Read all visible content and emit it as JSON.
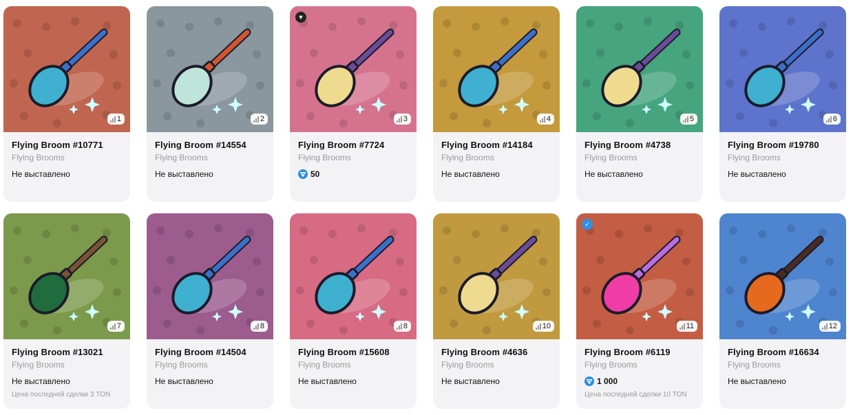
{
  "rank_icon": "signal-bars-icon",
  "cards": [
    {
      "title": "Flying Broom #10771",
      "collection": "Flying Brooms",
      "status": "Не выставлено",
      "price": "",
      "last_sale": "",
      "rank": "1",
      "bg": "#c0654f",
      "handle": "#3c6fc8",
      "brush": "#3fb0cf",
      "badge": "",
      "badge_color": ""
    },
    {
      "title": "Flying Broom #14554",
      "collection": "Flying Brooms",
      "status": "Не выставлено",
      "price": "",
      "last_sale": "",
      "rank": "2",
      "bg": "#8a979f",
      "handle": "#d2552f",
      "brush": "#bfe4da",
      "badge": "",
      "badge_color": ""
    },
    {
      "title": "Flying Broom #7724",
      "collection": "Flying Brooms",
      "status": "",
      "price": "50",
      "last_sale": "",
      "rank": "3",
      "bg": "#d5738f",
      "handle": "#6a4c97",
      "brush": "#eedb8f",
      "badge": "telegram-icon",
      "badge_color": "#222222"
    },
    {
      "title": "Flying Broom #14184",
      "collection": "Flying Brooms",
      "status": "Не выставлено",
      "price": "",
      "last_sale": "",
      "rank": "4",
      "bg": "#c49a3c",
      "handle": "#3c6fc8",
      "brush": "#3fb0cf",
      "badge": "",
      "badge_color": ""
    },
    {
      "title": "Flying Broom #4738",
      "collection": "Flying Brooms",
      "status": "Не выставлено",
      "price": "",
      "last_sale": "",
      "rank": "5",
      "bg": "#46a47f",
      "handle": "#6a4c97",
      "brush": "#eedb8f",
      "badge": "",
      "badge_color": ""
    },
    {
      "title": "Flying Broom #19780",
      "collection": "Flying Brooms",
      "status": "Не выставлено",
      "price": "",
      "last_sale": "",
      "rank": "6",
      "bg": "#5e73cc",
      "handle": "#3c6fc8",
      "brush": "#3fb0cf",
      "badge": "",
      "badge_color": ""
    },
    {
      "title": "Flying Broom #13021",
      "collection": "Flying Brooms",
      "status": "Не выставлено",
      "price": "",
      "last_sale": "Цена последней сделки 3 TON",
      "rank": "7",
      "bg": "#7c9a4c",
      "handle": "#7a5234",
      "brush": "#1f6c3c",
      "badge": "",
      "badge_color": ""
    },
    {
      "title": "Flying Broom #14504",
      "collection": "Flying Brooms",
      "status": "Не выставлено",
      "price": "",
      "last_sale": "",
      "rank": "8",
      "bg": "#9c5c8e",
      "handle": "#3c6fc8",
      "brush": "#3fb0cf",
      "badge": "",
      "badge_color": ""
    },
    {
      "title": "Flying Broom #15608",
      "collection": "Flying Brooms",
      "status": "Не выставлено",
      "price": "",
      "last_sale": "",
      "rank": "8",
      "bg": "#d76b84",
      "handle": "#3c6fc8",
      "brush": "#3fb0cf",
      "badge": "",
      "badge_color": ""
    },
    {
      "title": "Flying Broom #4636",
      "collection": "Flying Brooms",
      "status": "Не выставлено",
      "price": "",
      "last_sale": "",
      "rank": "10",
      "bg": "#c19a3f",
      "handle": "#6a4c97",
      "brush": "#eedb8f",
      "badge": "",
      "badge_color": ""
    },
    {
      "title": "Flying Broom #6119",
      "collection": "Flying Brooms",
      "status": "",
      "price": "1 000",
      "last_sale": "Цена последней сделки 10 TON",
      "rank": "11",
      "bg": "#c35d44",
      "handle": "#b96de0",
      "brush": "#ef3da5",
      "badge": "verified-icon",
      "badge_color": "#2f8fe3"
    },
    {
      "title": "Flying Broom #16634",
      "collection": "Flying Brooms",
      "status": "Не выставлено",
      "price": "",
      "last_sale": "",
      "rank": "12",
      "bg": "#4f84cf",
      "handle": "#4a2c22",
      "brush": "#e56a1d",
      "badge": "",
      "badge_color": ""
    }
  ]
}
